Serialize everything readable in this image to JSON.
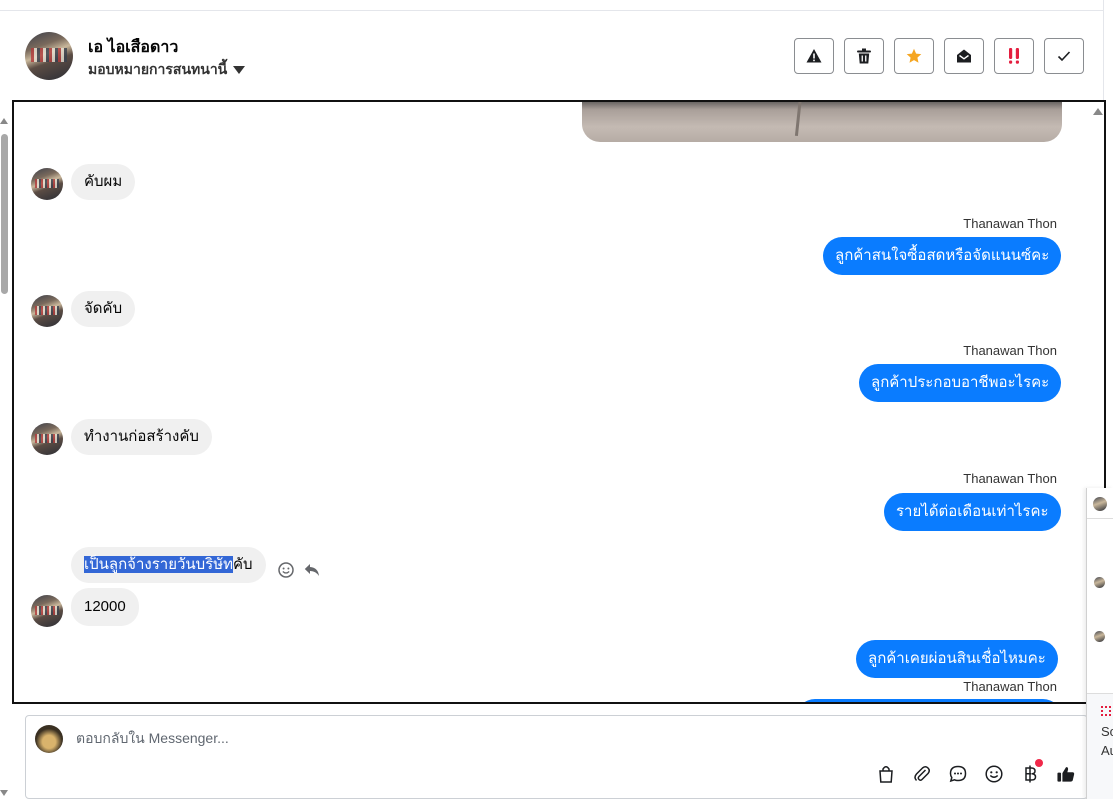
{
  "header": {
    "contact_name": "เอ ไอเสือดาว",
    "assign_label": "มอบหมายการสนทนานี้",
    "actions": [
      "report-icon",
      "trash-icon",
      "star-icon",
      "mark-read-icon",
      "priority-icon",
      "done-icon"
    ]
  },
  "chat": {
    "messages": [
      {
        "dir": "in",
        "text": "คับผม"
      },
      {
        "dir": "out",
        "sender": "Thanawan Thon",
        "text": "ลูกค้าสนใจซื้อสดหรือจัดแนนซ์คะ"
      },
      {
        "dir": "in",
        "text": "จัดคับ"
      },
      {
        "dir": "out",
        "sender": "Thanawan Thon",
        "text": "ลูกค้าประกอบอาชีพอะไรคะ"
      },
      {
        "dir": "in",
        "text": "ทำงานก่อสร้างคับ"
      },
      {
        "dir": "out",
        "sender": "Thanawan Thon",
        "text": "รายได้ต่อเดือนเท่าไรคะ"
      },
      {
        "dir": "in",
        "text_selected": "เป็นลูกจ้างรายวันบริษัท",
        "text_rest": "คับ"
      },
      {
        "dir": "in",
        "text": "12000"
      },
      {
        "dir": "out",
        "text": "ลูกค้าเคยผ่อนสินเชื่อไหมคะ"
      },
      {
        "dir": "out",
        "sender": "Thanawan Thon",
        "text": ""
      }
    ]
  },
  "composer": {
    "placeholder": "ตอบกลับใน Messenger...",
    "tools": [
      "bag-icon",
      "paperclip-icon",
      "saved-reply-icon",
      "emoji-icon",
      "baht-icon",
      "thumbs-up-icon"
    ]
  },
  "side_panel": {
    "text_1": "So",
    "text_2": "Au"
  },
  "colors": {
    "outgoing_bubble": "#0a7cff",
    "incoming_bubble": "#f0f0f0",
    "selection": "#3367d6",
    "star": "#f5a623",
    "priority": "#e41e3f"
  }
}
